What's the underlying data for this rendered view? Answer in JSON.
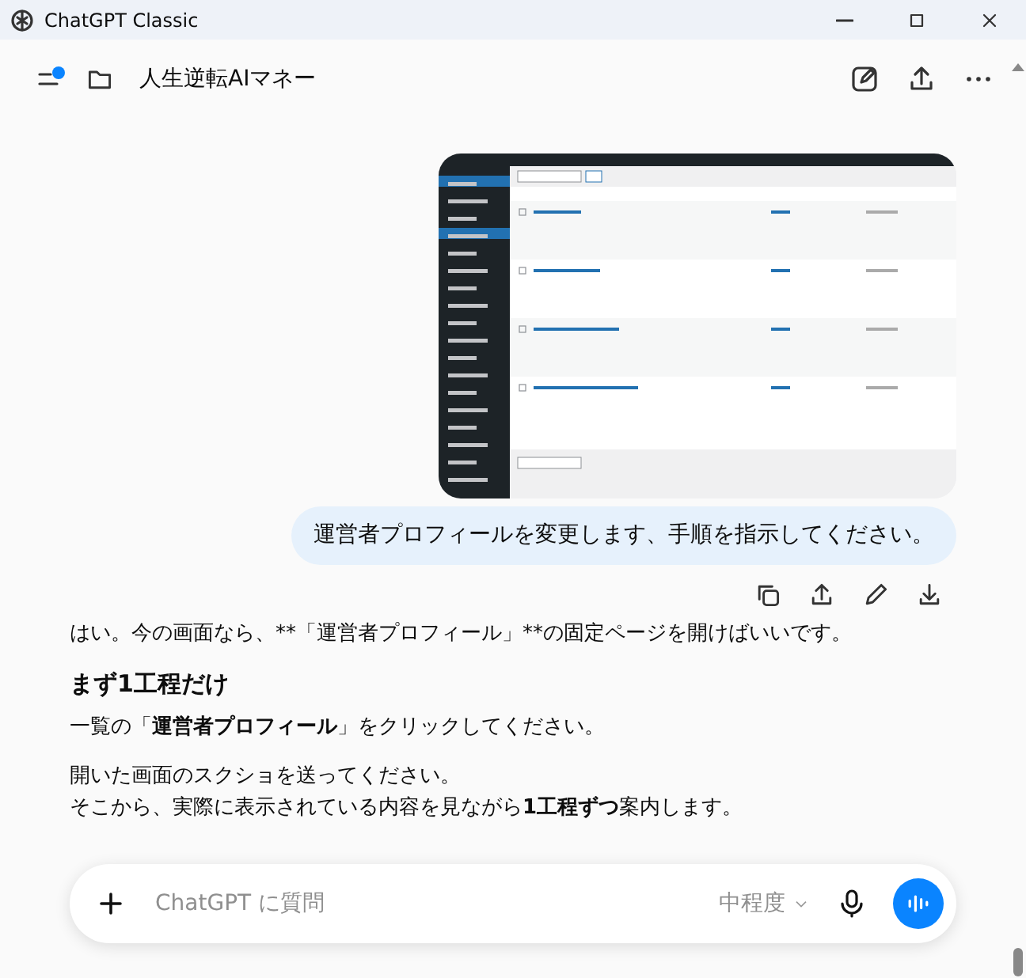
{
  "window": {
    "title": "ChatGPT Classic"
  },
  "header": {
    "project": "人生逆転AIマネー",
    "sidebar_unread": true
  },
  "user_message": {
    "text": "運営者プロフィールを変更します、手順を指示してください。"
  },
  "assistant_message": {
    "blocks": [
      {
        "kind": "plain",
        "text": "はい。今の画面なら、**「運営者プロフィール」**の固定ページを開けばいいです。"
      },
      {
        "kind": "heading",
        "text": "まず1工程だけ"
      },
      {
        "kind": "rich",
        "text": "一覧の「**運営者プロフィール**」をクリックしてください。"
      },
      {
        "kind": "rich",
        "text": "開いた画面のスクショを送ってください。"
      },
      {
        "kind": "line",
        "text": "そこから、実際に表示されている内容を見ながら**1工程ずつ**案内します。"
      }
    ]
  },
  "composer": {
    "placeholder": "ChatGPT に質問",
    "model": "中程度"
  }
}
